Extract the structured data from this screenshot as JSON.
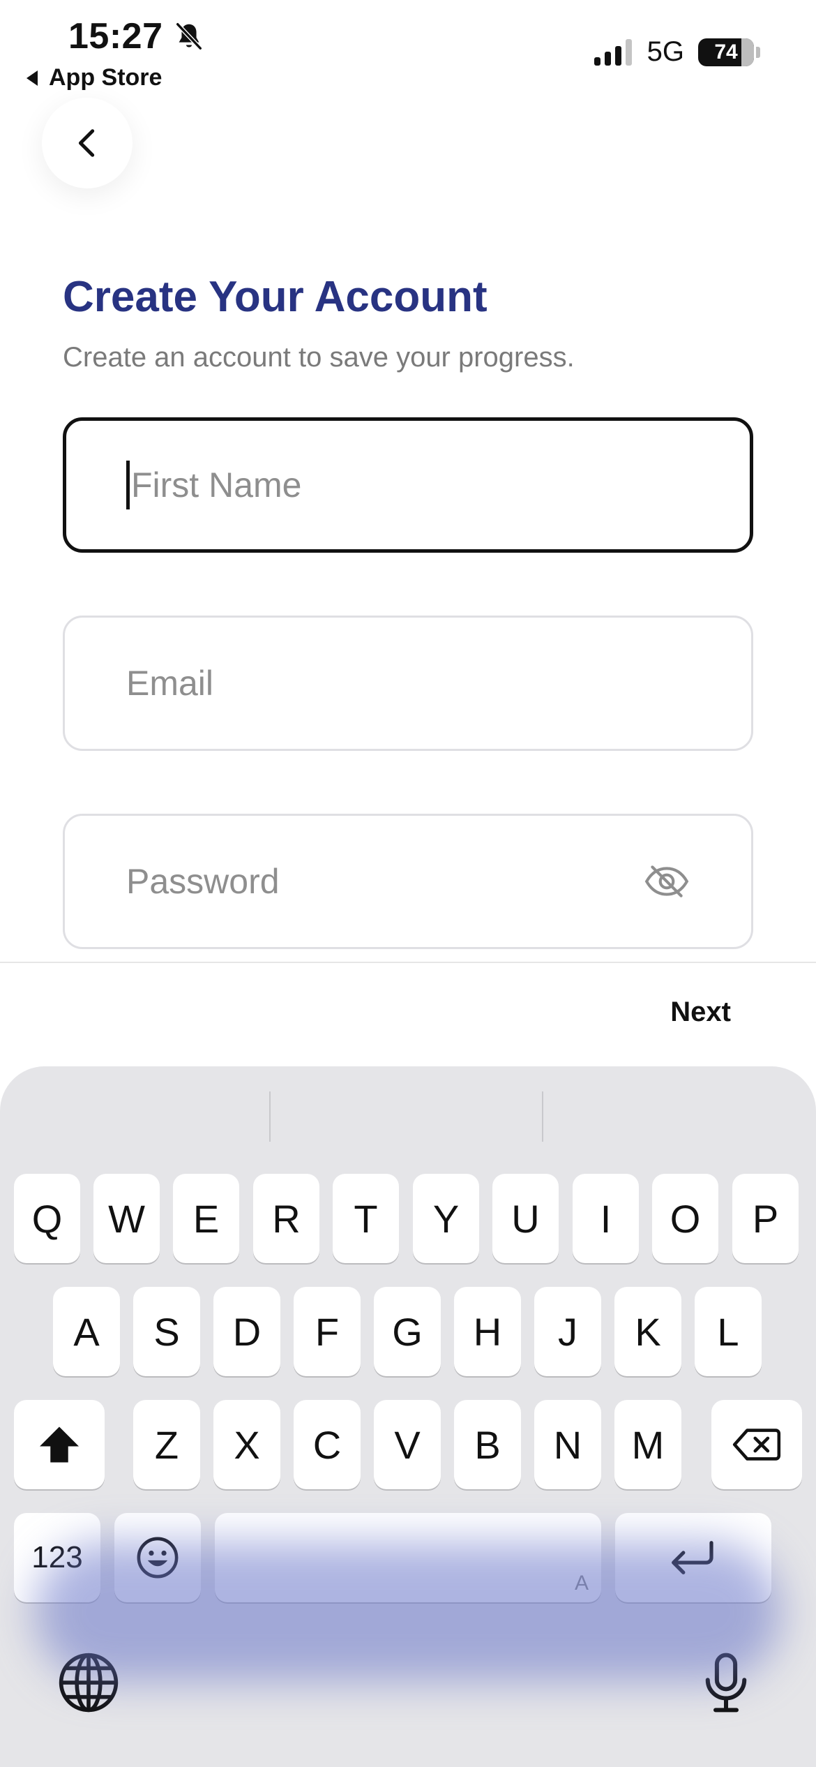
{
  "status_bar": {
    "time": "15:27",
    "back_app": "App Store",
    "network": "5G",
    "battery": "74"
  },
  "header": {
    "title": "Create Your Account",
    "subtitle": "Create an account to save your progress."
  },
  "form": {
    "first_name_placeholder": "First Name",
    "email_placeholder": "Email",
    "password_placeholder": "Password"
  },
  "accessory": {
    "next_label": "Next"
  },
  "keyboard": {
    "row1": [
      "Q",
      "W",
      "E",
      "R",
      "T",
      "Y",
      "U",
      "I",
      "O",
      "P"
    ],
    "row2": [
      "A",
      "S",
      "D",
      "F",
      "G",
      "H",
      "J",
      "K",
      "L"
    ],
    "row3": [
      "Z",
      "X",
      "C",
      "V",
      "B",
      "N",
      "M"
    ],
    "numbers_key": "123",
    "space_hint": "A"
  },
  "colors": {
    "title": "#283382",
    "accent_glow": "#6a76c8",
    "keyboard_bg": "#e5e5e8"
  }
}
